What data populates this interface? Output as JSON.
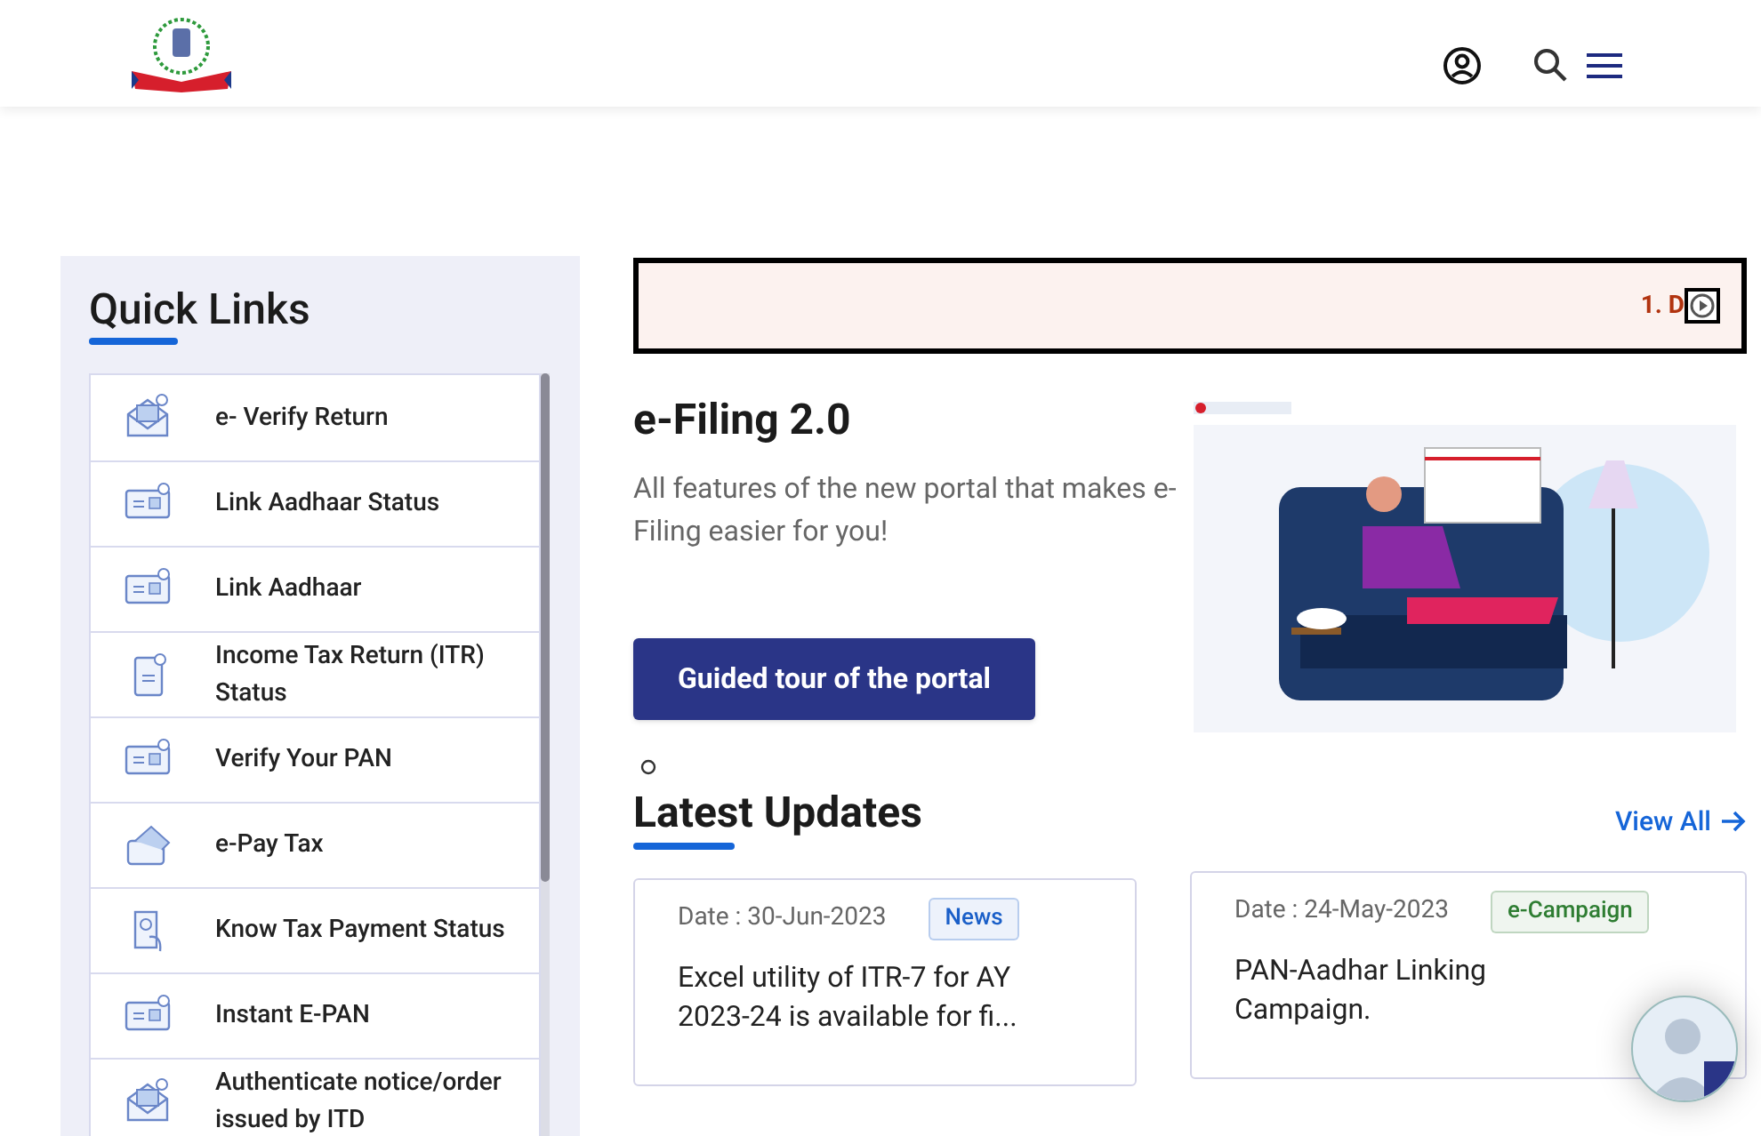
{
  "quick_links": {
    "title": "Quick Links",
    "items": [
      {
        "label": "e- Verify Return",
        "kind": "envelope"
      },
      {
        "label": "Link Aadhaar Status",
        "kind": "card"
      },
      {
        "label": "Link Aadhaar",
        "kind": "card"
      },
      {
        "label": "Income Tax Return (ITR) Status",
        "kind": "document"
      },
      {
        "label": "Verify Your PAN",
        "kind": "card"
      },
      {
        "label": "e-Pay Tax",
        "kind": "wallet"
      },
      {
        "label": "Know Tax Payment Status",
        "kind": "receipt"
      },
      {
        "label": "Instant E-PAN",
        "kind": "card"
      },
      {
        "label": "Authenticate notice/order issued by ITD",
        "kind": "envelope"
      }
    ]
  },
  "ticker": {
    "text": "1. D"
  },
  "hero": {
    "title": "e-Filing 2.0",
    "description": "All  features of the new portal that makes e-Filing easier for you!",
    "button": "Guided tour of the portal"
  },
  "latest_updates": {
    "title": "Latest Updates",
    "view_all": "View All",
    "items": [
      {
        "date": "Date : 30-Jun-2023",
        "tag": "News",
        "color": "#1a5fc8",
        "text": "Excel utility of ITR-7 for AY 2023-24 is available for fi..."
      },
      {
        "date": "Date : 24-May-2023",
        "tag": "e-Campaign",
        "color": "#2e7d32",
        "text": "PAN-Aadhar Linking Campaign."
      }
    ]
  }
}
